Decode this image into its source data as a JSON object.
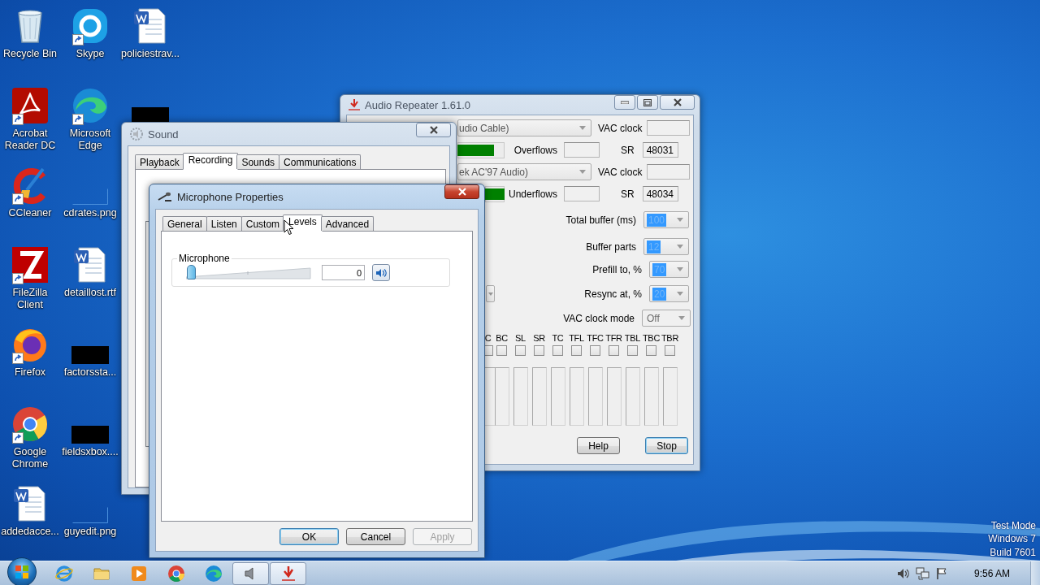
{
  "desktop_icons": [
    {
      "label": "Recycle Bin",
      "kind": "recycle"
    },
    {
      "label": "Acrobat\nReader DC",
      "kind": "acrobat",
      "shortcut": true
    },
    {
      "label": "CCleaner",
      "kind": "ccleaner",
      "shortcut": true
    },
    {
      "label": "FileZilla\nClient",
      "kind": "filezilla",
      "shortcut": true
    },
    {
      "label": "Firefox",
      "kind": "firefox",
      "shortcut": true
    },
    {
      "label": "Google\nChrome",
      "kind": "chrome",
      "shortcut": true
    },
    {
      "label": "addedacce...",
      "kind": "word"
    },
    {
      "label": "Skype",
      "kind": "skype",
      "shortcut": true
    },
    {
      "label": "Microsoft\nEdge",
      "kind": "edge",
      "shortcut": true
    },
    {
      "label": "cdrates.png",
      "kind": "blank"
    },
    {
      "label": "detaillost.rtf",
      "kind": "word"
    },
    {
      "label": "factorssta...",
      "kind": "redacted"
    },
    {
      "label": "fieldsxbox....",
      "kind": "redacted"
    },
    {
      "label": "guyedit.png",
      "kind": "blank"
    },
    {
      "label": "policiestrav...",
      "kind": "word"
    },
    {
      "kind": "redacted"
    }
  ],
  "audio_repeater": {
    "title": "Audio Repeater 1.61.0",
    "devices": [
      {
        "device": "udio Cable)",
        "clock_label": "VAC clock",
        "meter": {
          "level": 0.78
        },
        "counter_label": "Overflows",
        "sr_label": "SR",
        "sr": "48031"
      },
      {
        "device": "ek AC'97 Audio)",
        "clock_label": "VAC clock",
        "meter": {
          "level": 1
        },
        "counter_label": "Underflows",
        "sr_label": "SR",
        "sr": "48034"
      }
    ],
    "settings": [
      {
        "label": "Total buffer (ms)",
        "value": "100",
        "highlighted": true
      },
      {
        "label": "Buffer parts",
        "value": "12",
        "highlighted": true
      },
      {
        "label": "Prefill to, %",
        "value": "70",
        "highlighted": true
      },
      {
        "label": "Resync at, %",
        "value": "20",
        "highlighted": true
      },
      {
        "label": "VAC clock mode",
        "value": "Off",
        "highlighted": false
      }
    ],
    "channels": [
      {
        "label": "C",
        "checked": false
      },
      {
        "label": "BC",
        "checked": false
      },
      {
        "label": "SL",
        "checked": false
      },
      {
        "label": "SR",
        "checked": false
      },
      {
        "label": "TC",
        "checked": false
      },
      {
        "label": "TFL",
        "checked": false
      },
      {
        "label": "TFC",
        "checked": false
      },
      {
        "label": "TFR",
        "checked": false
      },
      {
        "label": "TBL",
        "checked": false
      },
      {
        "label": "TBC",
        "checked": false
      },
      {
        "label": "TBR",
        "checked": false
      }
    ],
    "buttons": [
      {
        "label": "Help",
        "focused": false
      },
      {
        "label": "Stop",
        "focused": true
      }
    ]
  },
  "sound_window": {
    "title": "Sound",
    "tabs": [
      {
        "label": "Playback",
        "selected": false
      },
      {
        "label": "Recording",
        "selected": true
      },
      {
        "label": "Sounds",
        "selected": false
      },
      {
        "label": "Communications",
        "selected": false
      }
    ]
  },
  "microphone_properties": {
    "title": "Microphone Properties",
    "tabs": [
      {
        "label": "General",
        "selected": false
      },
      {
        "label": "Listen",
        "selected": false
      },
      {
        "label": "Custom",
        "selected": false
      },
      {
        "label": "Levels",
        "selected": true
      },
      {
        "label": "Advanced",
        "selected": false
      }
    ],
    "group_label": "Microphone",
    "slider": {
      "level": 0
    },
    "value": "0",
    "buttons": [
      {
        "label": "OK",
        "default": true,
        "disabled": false
      },
      {
        "label": "Cancel",
        "default": false,
        "disabled": false
      },
      {
        "label": "Apply",
        "default": false,
        "disabled": true
      }
    ]
  },
  "taskbar": {
    "items": [
      {
        "kind": "ie",
        "active": false
      },
      {
        "kind": "explorer",
        "active": false
      },
      {
        "kind": "media",
        "active": false
      },
      {
        "kind": "chrome",
        "active": false
      },
      {
        "kind": "edge",
        "active": false
      },
      {
        "kind": "speaker",
        "active": true
      },
      {
        "kind": "repeater",
        "active": true
      }
    ],
    "clock": "9:56 AM"
  },
  "system_notice": [
    "Test Mode",
    "Windows 7",
    "Build 7601"
  ]
}
